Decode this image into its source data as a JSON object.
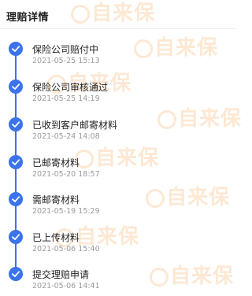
{
  "header": {
    "title": "理赔详情"
  },
  "watermark_text": "自来保",
  "accent_color": "#3b73ea",
  "timeline": [
    {
      "title": "保险公司赔付中",
      "time": "2021-05-25 15:13"
    },
    {
      "title": "保险公司审核通过",
      "time": "2021-05-25 14:19"
    },
    {
      "title": "已收到客户邮寄材料",
      "time": "2021-05-24 14:08"
    },
    {
      "title": "已邮寄材料",
      "time": "2021-05-20 18:57"
    },
    {
      "title": "需邮寄材料",
      "time": "2021-05-19 15:29"
    },
    {
      "title": "已上传材料",
      "time": "2021-05-06 15:40"
    },
    {
      "title": "提交理赔申请",
      "time": "2021-05-06 14:41"
    }
  ]
}
